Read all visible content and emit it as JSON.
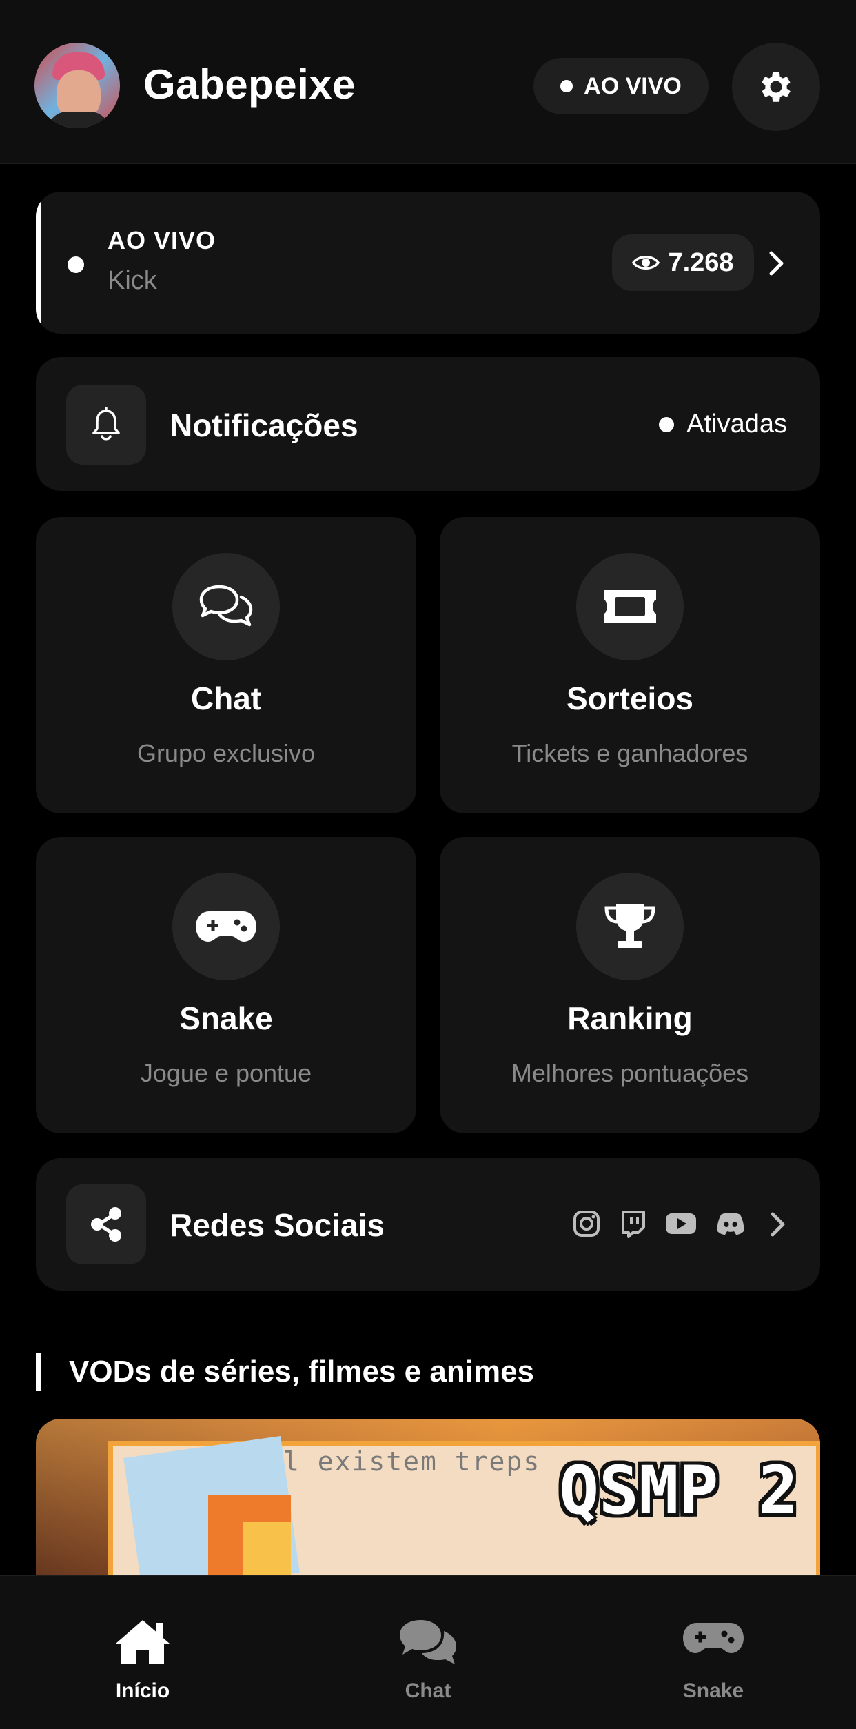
{
  "header": {
    "channel_name": "Gabepeixe",
    "live_badge": "AO VIVO"
  },
  "live_card": {
    "status": "AO VIVO",
    "platform": "Kick",
    "viewers": "7.268"
  },
  "notifications": {
    "label": "Notificações",
    "status": "Ativadas"
  },
  "tiles": [
    {
      "title": "Chat",
      "subtitle": "Grupo exclusivo",
      "icon": "chat-bubbles-icon"
    },
    {
      "title": "Sorteios",
      "subtitle": "Tickets e ganhadores",
      "icon": "ticket-icon"
    },
    {
      "title": "Snake",
      "subtitle": "Jogue e pontue",
      "icon": "gamepad-icon"
    },
    {
      "title": "Ranking",
      "subtitle": "Melhores pontuações",
      "icon": "trophy-icon"
    }
  ],
  "social": {
    "label": "Redes Sociais",
    "icons": [
      "instagram-icon",
      "twitch-icon",
      "youtube-icon",
      "discord-icon"
    ]
  },
  "vods": {
    "section_title": "VODs de séries, filmes e animes",
    "thumbnail_caption": "no brasil existem treps",
    "thumbnail_tag": "QSMP 2"
  },
  "bottom_nav": {
    "items": [
      {
        "label": "Início",
        "active": true
      },
      {
        "label": "Chat",
        "active": false
      },
      {
        "label": "Snake",
        "active": false
      }
    ]
  },
  "colors": {
    "background": "#000000",
    "card": "#141414",
    "accent": "#ffffff",
    "muted_text": "#8a8a8a",
    "inactive_nav": "#8a8a8a"
  }
}
